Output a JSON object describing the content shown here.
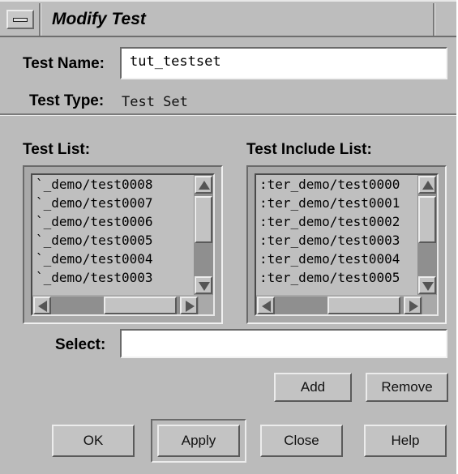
{
  "window": {
    "title": "Modify Test"
  },
  "test_name": {
    "label": "Test Name:",
    "value": "tut_testset"
  },
  "test_type": {
    "label": "Test Type:",
    "value": "Test Set"
  },
  "test_list": {
    "label": "Test List:",
    "items": [
      "`_demo/test0008",
      "`_demo/test0007",
      "`_demo/test0006",
      "`_demo/test0005",
      "`_demo/test0004",
      "`_demo/test0003"
    ]
  },
  "include_list": {
    "label": "Test Include List:",
    "items": [
      ":ter_demo/test0000",
      ":ter_demo/test0001",
      ":ter_demo/test0002",
      ":ter_demo/test0003",
      ":ter_demo/test0004",
      ":ter_demo/test0005"
    ]
  },
  "select": {
    "label": "Select:",
    "value": ""
  },
  "buttons": {
    "add": "Add",
    "remove": "Remove",
    "ok": "OK",
    "apply": "Apply",
    "close": "Close",
    "help": "Help"
  }
}
